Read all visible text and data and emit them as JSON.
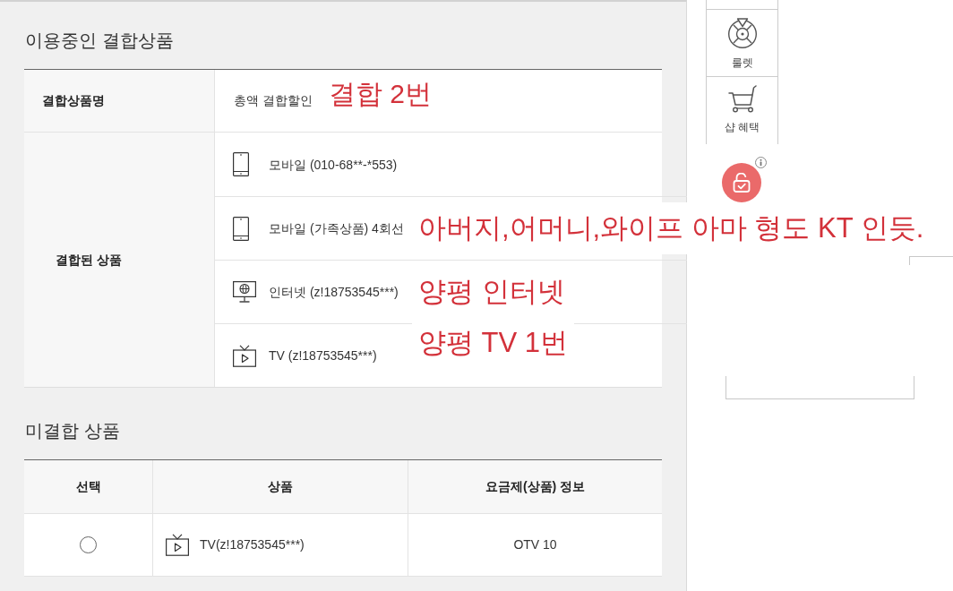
{
  "in_use": {
    "title": "이용중인 결합상품",
    "name_row": {
      "label": "결합상품명",
      "value": "총액 결합할인",
      "annotation": "결합 2번"
    },
    "combined_row": {
      "label": "결합된 상품",
      "items": [
        {
          "kind": "mobile",
          "text": "모바일 (010-68**-*553)"
        },
        {
          "kind": "mobile",
          "text": "모바일 (가족상품) 4회선",
          "annotation": "아버지,어머니,와이프 아마 형도 KT 인듯."
        },
        {
          "kind": "internet",
          "text": "인터넷 (z!18753545***)",
          "annotation": "양평 인터넷"
        },
        {
          "kind": "tv",
          "text": "TV (z!18753545***)",
          "annotation": "양평 TV 1번"
        }
      ]
    }
  },
  "uncombined": {
    "title": "미결합 상품",
    "columns": [
      "선택",
      "상품",
      "요금제(상품) 정보"
    ],
    "rows": [
      {
        "selected": false,
        "kind": "tv",
        "product": "TV(z!18753545***)",
        "plan": "OTV 10"
      }
    ]
  },
  "quick_menu": {
    "items": [
      {
        "kind": "roulette",
        "label": "룰렛"
      },
      {
        "kind": "cart",
        "label": "샵 혜택"
      }
    ]
  }
}
